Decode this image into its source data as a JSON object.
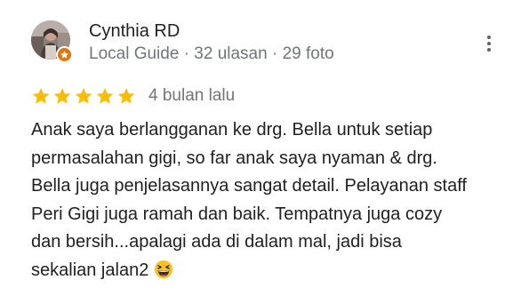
{
  "review": {
    "reviewer": {
      "name": "Cynthia RD",
      "meta": "Local Guide · 32 ulasan · 29 foto",
      "avatar_icon": "profile-photo",
      "badge_icon": "local-guide-star-icon",
      "badge_color": "#e8710a"
    },
    "rating": {
      "stars": 5,
      "max_stars": 5,
      "star_color": "#fbbc04"
    },
    "date": "4 bulan lalu",
    "text_lines": [
      "Anak saya berlangganan ke drg. Bella untuk setiap",
      "permasalahan gigi, so far anak saya nyaman & drg.",
      "Bella juga penjelasannya sangat detail. Pelayanan staff",
      "Peri Gigi juga ramah dan baik. Tempatnya juga cozy",
      "dan bersih...apalagi ada di dalam mal, jadi bisa",
      "sekalian jalan2"
    ],
    "emoji_icon": "grinning-squinting-face-emoji",
    "more_icon": "more-vertical-icon"
  }
}
